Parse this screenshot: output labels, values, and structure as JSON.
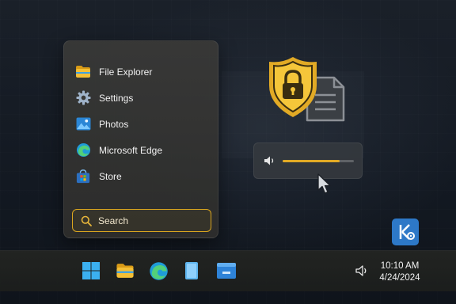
{
  "start_menu": {
    "items": [
      {
        "label": "File Explorer",
        "icon": "folder-icon"
      },
      {
        "label": "Settings",
        "icon": "gear-icon"
      },
      {
        "label": "Photos",
        "icon": "photos-icon"
      },
      {
        "label": "Microsoft Edge",
        "icon": "edge-icon"
      },
      {
        "label": "Store",
        "icon": "store-icon"
      }
    ],
    "search": {
      "label": "Search",
      "icon": "search-icon"
    }
  },
  "security_graphic": {
    "icons": [
      "shield-lock-icon",
      "document-icon"
    ]
  },
  "volume_flyout": {
    "icon": "speaker-icon",
    "level_percent": 80
  },
  "pointer": {
    "icon": "mouse-cursor-icon"
  },
  "desktop": {
    "kde_icon": "kde-icon"
  },
  "taskbar": {
    "pinned": [
      "windows-start-icon",
      "file-explorer-icon",
      "edge-icon",
      "tablet-icon",
      "store-window-icon"
    ],
    "tray": {
      "volume_icon": "speaker-icon",
      "time": "10:10 AM",
      "date": "4/24/2024"
    }
  },
  "colors": {
    "accent": "#e2aa25",
    "kde": "#2d78c7",
    "edge_blue": "#1f9cd8"
  }
}
